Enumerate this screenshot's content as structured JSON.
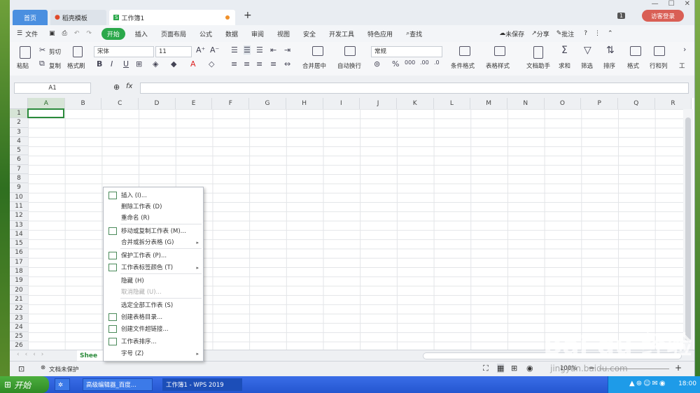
{
  "tabs": {
    "home": "首页",
    "template": "稻壳模板",
    "book": "工作簿1"
  },
  "titlebar": {
    "counter": "1",
    "login": "访客登录"
  },
  "menu": {
    "file": "文件",
    "items": [
      "开始",
      "插入",
      "页面布局",
      "公式",
      "数据",
      "审阅",
      "视图",
      "安全",
      "开发工具",
      "特色应用"
    ],
    "search": "查找",
    "right": {
      "unsaved": "未保存",
      "share": "分享",
      "comment": "批注"
    }
  },
  "ribbon": {
    "paste": "粘贴",
    "cut": "剪切",
    "copy": "复制",
    "format_painter": "格式刷",
    "font": "宋体",
    "size": "11",
    "merge": "合并居中",
    "wrap": "自动换行",
    "number_format": "常规",
    "cond_format": "条件格式",
    "table_style": "表格样式",
    "doc_helper": "文档助手",
    "sum": "求和",
    "filter": "筛选",
    "sort": "排序",
    "format": "格式",
    "rowcol": "行和列",
    "worksheet": "工"
  },
  "formula": {
    "cell_ref": "A1",
    "fx": "fx"
  },
  "grid": {
    "columns": [
      "A",
      "B",
      "C",
      "D",
      "E",
      "F",
      "G",
      "H",
      "I",
      "J",
      "K",
      "L",
      "M",
      "N",
      "O",
      "P",
      "Q",
      "R"
    ],
    "rows": [
      "1",
      "2",
      "3",
      "4",
      "5",
      "6",
      "7",
      "8",
      "9",
      "10",
      "11",
      "12",
      "13",
      "14",
      "15",
      "16",
      "17",
      "18",
      "19",
      "20",
      "21",
      "22",
      "23",
      "24",
      "25",
      "26"
    ]
  },
  "context_menu": [
    {
      "label": "插入 (I)...",
      "arrow": false,
      "disabled": false
    },
    {
      "label": "删除工作表 (D)",
      "arrow": false,
      "disabled": false
    },
    {
      "label": "重命名 (R)",
      "arrow": false,
      "disabled": false
    },
    {
      "label": "移动或复制工作表 (M)...",
      "arrow": false,
      "disabled": false
    },
    {
      "label": "合并或拆分表格 (G)",
      "arrow": true,
      "disabled": false
    },
    {
      "label": "保护工作表 (P)...",
      "arrow": false,
      "disabled": false
    },
    {
      "label": "工作表标签颜色 (T)",
      "arrow": true,
      "disabled": false
    },
    {
      "label": "隐藏 (H)",
      "arrow": false,
      "disabled": false
    },
    {
      "label": "取消隐藏 (U)...",
      "arrow": false,
      "disabled": true
    },
    {
      "label": "选定全部工作表 (S)",
      "arrow": false,
      "disabled": false
    },
    {
      "label": "创建表格目录...",
      "arrow": false,
      "disabled": false
    },
    {
      "label": "创建文件超链接...",
      "arrow": false,
      "disabled": false
    },
    {
      "label": "工作表排序...",
      "arrow": false,
      "disabled": false
    },
    {
      "label": "字号 (Z)",
      "arrow": true,
      "disabled": false
    }
  ],
  "sheet": {
    "tab": "Shee"
  },
  "status": {
    "protect": "文档未保护",
    "zoom": "100%"
  },
  "watermark": {
    "main": "Bai du 经验",
    "sub": "jingyan.baidu.com"
  },
  "taskbar": {
    "start": "开始",
    "task1": "高级编辑器_百度...",
    "task2": "工作簿1 - WPS 2019",
    "clock": "18:00"
  },
  "colors": {
    "accent_green": "#2aa84a",
    "home_tab": "#4a8fe0",
    "login": "#d95f55",
    "taskbar": "#2456d0"
  }
}
